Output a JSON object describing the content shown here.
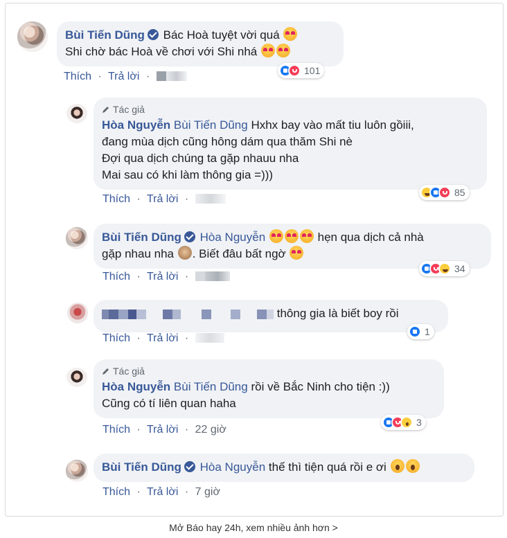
{
  "comments": [
    {
      "author": "Bùi Tiến Dũng",
      "lines": [
        "Bác Hoà tuyệt vời quá",
        "Shi chờ bác Hoà về chơi với Shi nhá"
      ],
      "like_label": "Thích",
      "reply_label": "Trả lời",
      "reactions": [
        "like",
        "love"
      ],
      "reaction_count": "101"
    },
    {
      "author_tag": "Tác giả",
      "author": "Hòa Nguyễn",
      "mention": "Bùi Tiến Dũng",
      "lines": [
        "Hxhx bay vào mất tiu luôn gồiii,",
        "đang mùa dịch cũng hông dám qua thăm Shi nè",
        "Đợi qua dịch chúng ta gặp nhauu nha",
        "Mai sau có khi làm thông gia =)))"
      ],
      "like_label": "Thích",
      "reply_label": "Trả lời",
      "reactions": [
        "haha",
        "like",
        "love"
      ],
      "reaction_count": "85"
    },
    {
      "author": "Bùi Tiến Dũng",
      "mention": "Hòa Nguyễn",
      "lines": [
        "hẹn qua dịch cả nhà",
        "gặp nhau nha",
        ". Biết đâu bất ngờ"
      ],
      "like_label": "Thích",
      "reply_label": "Trả lời",
      "reactions": [
        "like",
        "love",
        "haha"
      ],
      "reaction_count": "34"
    },
    {
      "text": "thông gia là biết boy rồi",
      "like_label": "Thích",
      "reply_label": "Trả lời",
      "reactions": [
        "like"
      ],
      "reaction_count": "1"
    },
    {
      "author_tag": "Tác giả",
      "author": "Hòa Nguyễn",
      "mention": "Bùi Tiến Dũng",
      "lines": [
        "rồi về Bắc Ninh cho tiện :))",
        "Cũng có tí liên quan haha"
      ],
      "like_label": "Thích",
      "reply_label": "Trả lời",
      "time": "22 giờ",
      "reactions": [
        "like",
        "love",
        "wow"
      ],
      "reaction_count": "3"
    },
    {
      "author": "Bùi Tiến Dũng",
      "mention": "Hòa Nguyễn",
      "text": "thế thì tiện quá rồi e ơi",
      "like_label": "Thích",
      "reply_label": "Trả lời",
      "time": "7 giờ"
    }
  ],
  "footer": {
    "link_text": "Mở Báo hay 24h, xem nhiều ảnh hơn >"
  },
  "colors": {
    "name": "#385898",
    "bubble": "#f0f2f5",
    "like": "#1877f2",
    "love": "#f33e58"
  }
}
